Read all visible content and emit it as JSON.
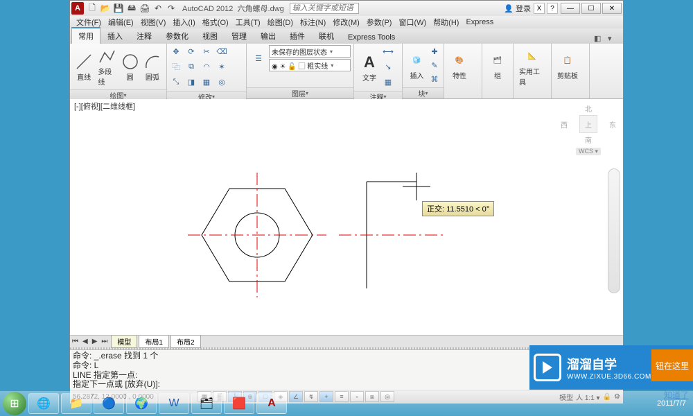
{
  "app": {
    "name": "AutoCAD 2012",
    "file": "六角螺母.dwg",
    "search_placeholder": "输入关键字或短语",
    "login": "登录"
  },
  "win": {
    "min": "—",
    "max": "☐",
    "close": "✕"
  },
  "menu": [
    "文件(F)",
    "编辑(E)",
    "视图(V)",
    "插入(I)",
    "格式(O)",
    "工具(T)",
    "绘图(D)",
    "标注(N)",
    "修改(M)",
    "参数(P)",
    "窗口(W)",
    "帮助(H)",
    "Express"
  ],
  "tabs": [
    "常用",
    "插入",
    "注释",
    "参数化",
    "视图",
    "管理",
    "输出",
    "插件",
    "联机",
    "Express Tools"
  ],
  "panels": {
    "draw": {
      "title": "绘图",
      "items": [
        "直线",
        "多段线",
        "圆",
        "圆弧"
      ]
    },
    "modify": {
      "title": "修改"
    },
    "layer": {
      "title": "图层",
      "layer_state": "未保存的图层状态",
      "current": "◉ ☀ 🔓 ▢ 粗实线"
    },
    "annot": {
      "title": "注释",
      "text": "文字"
    },
    "insert": {
      "title": "块",
      "btn": "插入"
    },
    "prop": {
      "title": "特性"
    },
    "group": {
      "title": "组"
    },
    "util": {
      "title": "实用工具"
    },
    "clip": {
      "title": "剪贴板"
    }
  },
  "view_label": "[-][俯视][二维线框]",
  "viewcube": {
    "n": "北",
    "s": "南",
    "e": "东",
    "w": "西",
    "top": "上",
    "wcs": "WCS ▾"
  },
  "tooltip": "正交: 11.5510 < 0°",
  "sheets": [
    "模型",
    "布局1",
    "布局2"
  ],
  "cmd": {
    "l1": "命令: _.erase 找到 1 个",
    "l2": "命令: L",
    "l3": "LINE 指定第一点:",
    "l4": "指定下一点或 [放弃(U)]:"
  },
  "status": {
    "coords": "56.2872, 12.0000 , 0.0000",
    "model": "模型",
    "scale": "1:1",
    "annoscale": "人 1:1 ▾"
  },
  "brand": {
    "big": "溜溜自学",
    "small": "WWW.ZIXUE.3D66.COM"
  },
  "side": "钮在这里",
  "know": "知道了",
  "tray_date": "2011/7/7"
}
